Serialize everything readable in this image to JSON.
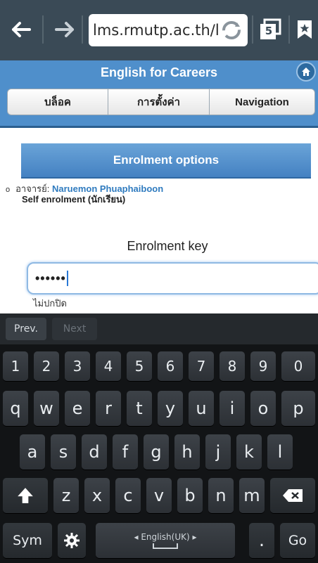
{
  "browser": {
    "url": "lms.rmutp.ac.th/l",
    "tab_count": "5",
    "icons": [
      "back-arrow-icon",
      "forward-arrow-icon",
      "reload-icon",
      "tabs-icon",
      "bookmark-star-icon"
    ]
  },
  "site": {
    "title": "English for Careers",
    "home_icon": "home-icon",
    "segments": [
      "บล็อค",
      "การตั้งค่า",
      "Navigation"
    ]
  },
  "content": {
    "section_title": "Enrolment options",
    "teacher_label": "อาจารย์: ",
    "teacher_name": "Naruemon Phuaphaiboon",
    "self_enrolment": "Self enrolment (นักเรียน)",
    "enrolment_key_label": "Enrolment key",
    "enrolment_key_value": "••••••",
    "unmask_label": "ไม่ปกปิด"
  },
  "keyboard": {
    "toolbar": {
      "prev": "Prev.",
      "next": "Next"
    },
    "numbers": [
      "1",
      "2",
      "3",
      "4",
      "5",
      "6",
      "7",
      "8",
      "9",
      "0"
    ],
    "row1": [
      "q",
      "w",
      "e",
      "r",
      "t",
      "y",
      "u",
      "i",
      "o",
      "p"
    ],
    "row2": [
      "a",
      "s",
      "d",
      "f",
      "g",
      "h",
      "j",
      "k",
      "l"
    ],
    "row3": [
      "z",
      "x",
      "c",
      "v",
      "b",
      "n",
      "m"
    ],
    "sym": "Sym",
    "language": "English(UK)",
    "period": ".",
    "go": "Go"
  }
}
